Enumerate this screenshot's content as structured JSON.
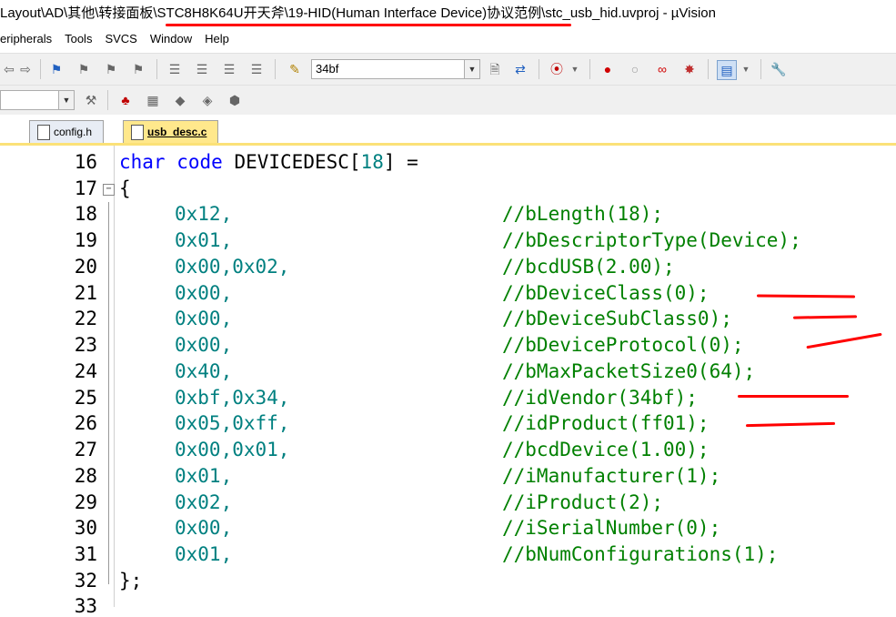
{
  "window": {
    "title_pre": "Layout\\AD\\其他\\转接面板\\",
    "title_underlined": "STC8H8K64U开天斧\\19-HID(Human Interface Device)协议范例",
    "title_post": "\\stc_usb_hid.uvproj - µVision"
  },
  "menu": [
    "eripherals",
    "Tools",
    "SVCS",
    "Window",
    "Help"
  ],
  "toolbar": {
    "target_value": "34bf"
  },
  "tabs": [
    {
      "label": "config.h",
      "active": false
    },
    {
      "label": "usb_desc.c",
      "active": true
    }
  ],
  "editor": {
    "line_numbers": [
      "16",
      "17",
      "18",
      "19",
      "20",
      "21",
      "22",
      "23",
      "24",
      "25",
      "26",
      "27",
      "28",
      "29",
      "30",
      "31",
      "32",
      "33"
    ],
    "decl": {
      "kw1": "char",
      "kw2": "code",
      "name": "DEVICEDESC[",
      "size": "18",
      "rest": "] ="
    },
    "open_brace": "{",
    "rows": [
      {
        "value": "0x12,",
        "comment": "//bLength(18);"
      },
      {
        "value": "0x01,",
        "comment": "//bDescriptorType(Device);"
      },
      {
        "value": "0x00,0x02,",
        "comment": "//bcdUSB(2.00);"
      },
      {
        "value": "0x00,",
        "comment": "//bDeviceClass(0);"
      },
      {
        "value": "0x00,",
        "comment": "//bDeviceSubClass0);"
      },
      {
        "value": "0x00,",
        "comment": "//bDeviceProtocol(0);"
      },
      {
        "value": "0x40,",
        "comment": "//bMaxPacketSize0(64);"
      },
      {
        "value": "0xbf,0x34,",
        "comment": "//idVendor(34bf);"
      },
      {
        "value": "0x05,0xff,",
        "comment": "//idProduct(ff01);"
      },
      {
        "value": "0x00,0x01,",
        "comment": "//bcdDevice(1.00);"
      },
      {
        "value": "0x01,",
        "comment": "//iManufacturer(1);"
      },
      {
        "value": "0x02,",
        "comment": "//iProduct(2);"
      },
      {
        "value": "0x00,",
        "comment": "//iSerialNumber(0);"
      },
      {
        "value": "0x01,",
        "comment": "//bNumConfigurations(1);"
      }
    ],
    "close_brace": "};"
  },
  "colors": {
    "keyword": "#0000ff",
    "number": "#008080",
    "comment": "#008000",
    "annotation": "#ff0000",
    "active_tab": "#ffe88c"
  }
}
